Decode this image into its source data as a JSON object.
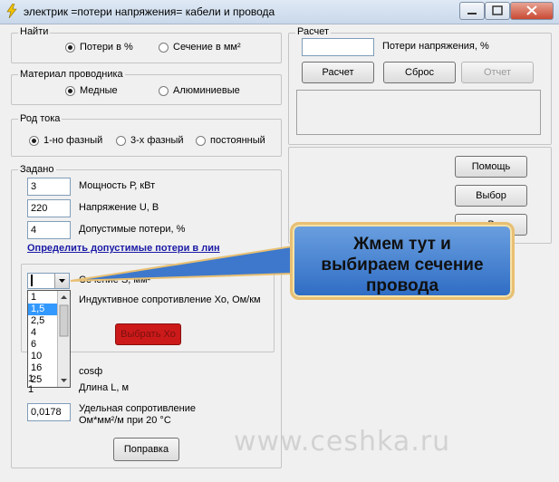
{
  "window": {
    "title": "электрик =потери напряжения= кабели и провода"
  },
  "find": {
    "label": "Найти",
    "options": [
      {
        "label": "Потери в %",
        "selected": true
      },
      {
        "label": "Сечение в мм²",
        "selected": false
      }
    ]
  },
  "material": {
    "label": "Материал проводника",
    "options": [
      {
        "label": "Медные",
        "selected": true
      },
      {
        "label": "Алюминиевые",
        "selected": false
      }
    ]
  },
  "current": {
    "label": "Род тока",
    "options": [
      {
        "label": "1-но фазный",
        "selected": true
      },
      {
        "label": "3-х фазный",
        "selected": false
      },
      {
        "label": "постоянный",
        "selected": false
      }
    ]
  },
  "given": {
    "label": "Задано",
    "power": {
      "value": "3",
      "label": "Мощность Р, кВт"
    },
    "voltage": {
      "value": "220",
      "label": "Напряжение U, В"
    },
    "losses": {
      "value": "4",
      "label": "Допустимые потери, %"
    },
    "link": "Определить допустимые потери в лин",
    "section_label": "Сечение S, мм²",
    "section_value": "",
    "inductive_label": "Индуктивное сопротивление Хо, Ом/км",
    "select_x0": "Выбрать Хо",
    "cos_label": "cosф",
    "length_label": "Длина L, м",
    "resistivity": {
      "value": "0,0178",
      "label_line1": "Удельная сопротивление",
      "label_line2": "Ом*мм²/м при 20 °С"
    },
    "correction_button": "Поправка",
    "dropdown_items": [
      "1",
      "1,5",
      "2,5",
      "4",
      "6",
      "10",
      "16",
      "25"
    ],
    "dropdown_selected_index": 1,
    "rows_left_values": [
      "1",
      "1"
    ]
  },
  "calc": {
    "label": "Расчет",
    "result_value": "",
    "result_label": "Потери напряжения, %",
    "calc_button": "Расчет",
    "reset_button": "Сброс",
    "report_button": "Отчет"
  },
  "side": {
    "help_button": "Помощь",
    "choose_button": "Выбор",
    "third_button_partial": "В"
  },
  "callout": {
    "line1": "Жмем тут и",
    "line2": "выбираем сечение",
    "line3": "провода"
  },
  "watermark": "www.ceshka.ru",
  "colors": {
    "link": "#1a1aa6",
    "red_button": "#cc1a1a",
    "callout": "#2e6cc4",
    "list_selected": "#3399ff"
  }
}
